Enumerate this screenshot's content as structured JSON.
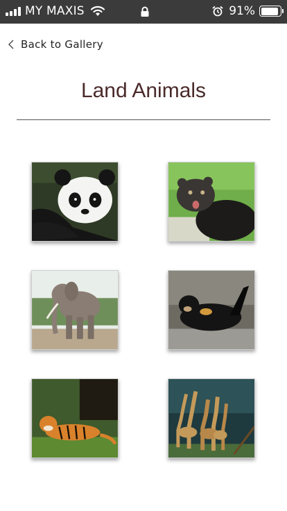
{
  "status_bar": {
    "carrier": "MY MAXIS",
    "battery_percent": "91%",
    "battery_level": 0.91,
    "icons": [
      "signal-icon",
      "wifi-icon",
      "lock-icon",
      "alarm-icon",
      "battery-icon"
    ]
  },
  "nav": {
    "back_label": "Back to Gallery",
    "back_icon": "chevron-left-icon"
  },
  "page": {
    "title": "Land Animals"
  },
  "gallery": {
    "tiles": [
      {
        "subject": "panda",
        "colors": {
          "bg": "#2e3a25",
          "main": "#f4f4f2",
          "dark": "#151515"
        }
      },
      {
        "subject": "binturong",
        "colors": {
          "bg": "#6fae4a",
          "main": "#3a3634",
          "dark": "#1d1b1a"
        }
      },
      {
        "subject": "elephant",
        "colors": {
          "bg": "#e8eee9",
          "main": "#8a7d74",
          "dark": "#5c5149"
        }
      },
      {
        "subject": "sun-bear",
        "colors": {
          "bg": "#6d6a62",
          "main": "#141414",
          "dark": "#0a0a0a"
        }
      },
      {
        "subject": "tiger",
        "colors": {
          "bg": "#3f5a2c",
          "main": "#d9822b",
          "dark": "#1f1a12"
        }
      },
      {
        "subject": "giraffes",
        "colors": {
          "bg": "#1f3a3e",
          "main": "#c49a5a",
          "dark": "#6b4a24"
        }
      }
    ]
  }
}
